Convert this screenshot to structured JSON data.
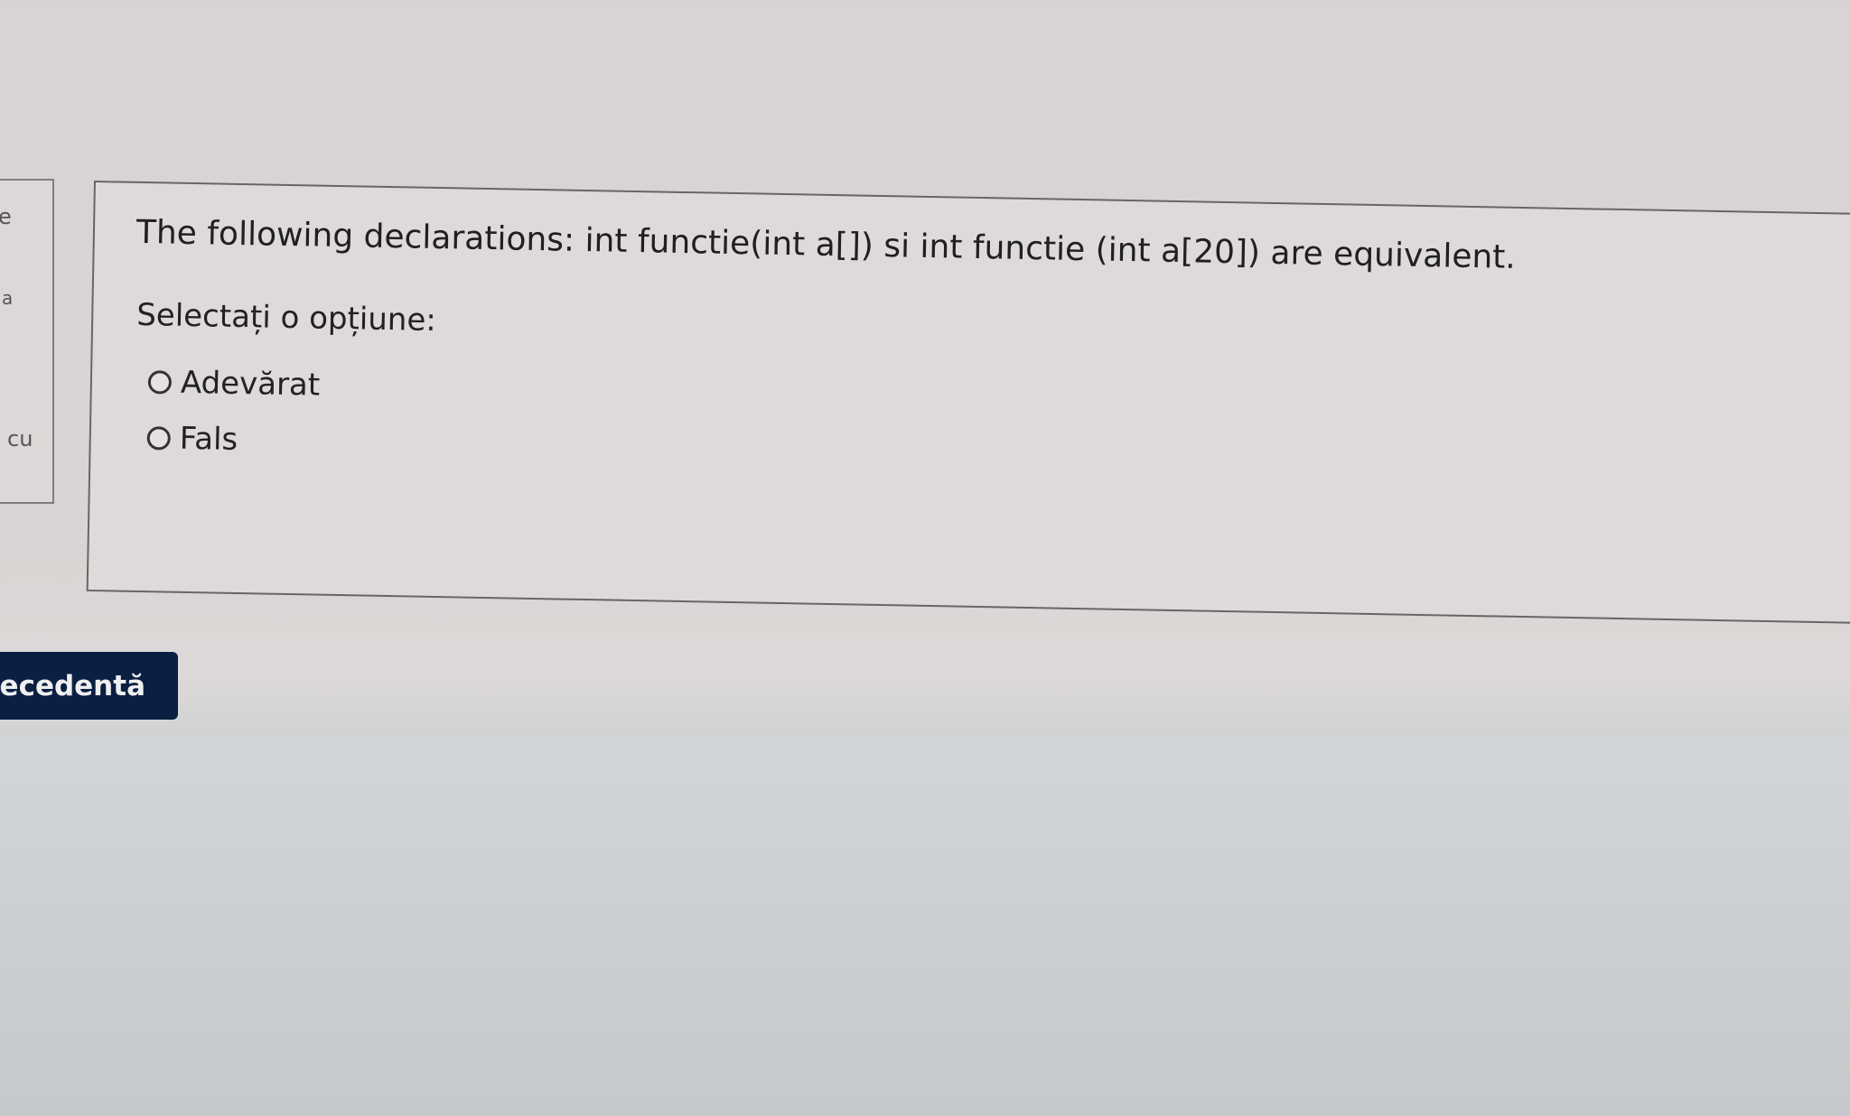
{
  "left_panel": {
    "fragments": [
      "e",
      "a",
      "cu"
    ]
  },
  "question": {
    "text": "The following declarations:  int functie(int a[]) si int functie (int a[20]) are equivalent.",
    "prompt": "Selectați o opțiune:",
    "options": [
      {
        "label": "Adevărat",
        "selected": false
      },
      {
        "label": "Fals",
        "selected": false
      }
    ]
  },
  "navigation": {
    "previous_label": "recedentă"
  },
  "colors": {
    "button_bg": "#0b1f43",
    "button_text": "#f0f0f0",
    "card_border": "#666666",
    "text": "#202020"
  }
}
